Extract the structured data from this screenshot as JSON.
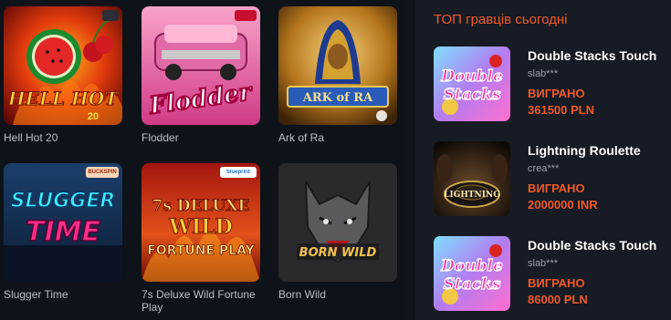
{
  "games": [
    {
      "name": "Hell Hot 20",
      "art_text": "HELL HOT",
      "art_sub": "20"
    },
    {
      "name": "Flodder",
      "art_text": "Flodder"
    },
    {
      "name": "Ark of Ra",
      "art_text": "ARK of RA",
      "art_sub": "CIRCULAR ARROW"
    },
    {
      "name": "Slugger Time",
      "art_text": "SLUGGER",
      "art_sub": "TIME",
      "badge": "BUCKSPIN"
    },
    {
      "name": "7s Deluxe Wild Fortune Play",
      "art_text": "7s DELUXE",
      "art_sub": "WILD",
      "art_sub2": "FORTUNE PLAY",
      "badge": "blueprint"
    },
    {
      "name": "Born Wild",
      "art_text": "BORN WILD"
    }
  ],
  "top_players": {
    "title": "ТОП гравців сьогодні",
    "entries": [
      {
        "game": "Double Stacks Touch",
        "user": "slab***",
        "label": "ВИГРАНО",
        "amount": "361500 PLN",
        "art_text": "Double",
        "art_sub": "Stacks"
      },
      {
        "game": "Lightning Roulette",
        "user": "crea***",
        "label": "ВИГРАНО",
        "amount": "2000000 INR",
        "art_text": "LIGHTNING"
      },
      {
        "game": "Double Stacks Touch",
        "user": "slab***",
        "label": "ВИГРАНО",
        "amount": "86000 PLN",
        "art_text": "Double",
        "art_sub": "Stacks"
      }
    ]
  },
  "colors": {
    "accent": "#ef5a2a",
    "background": "#10141b",
    "panel": "#171b23"
  }
}
